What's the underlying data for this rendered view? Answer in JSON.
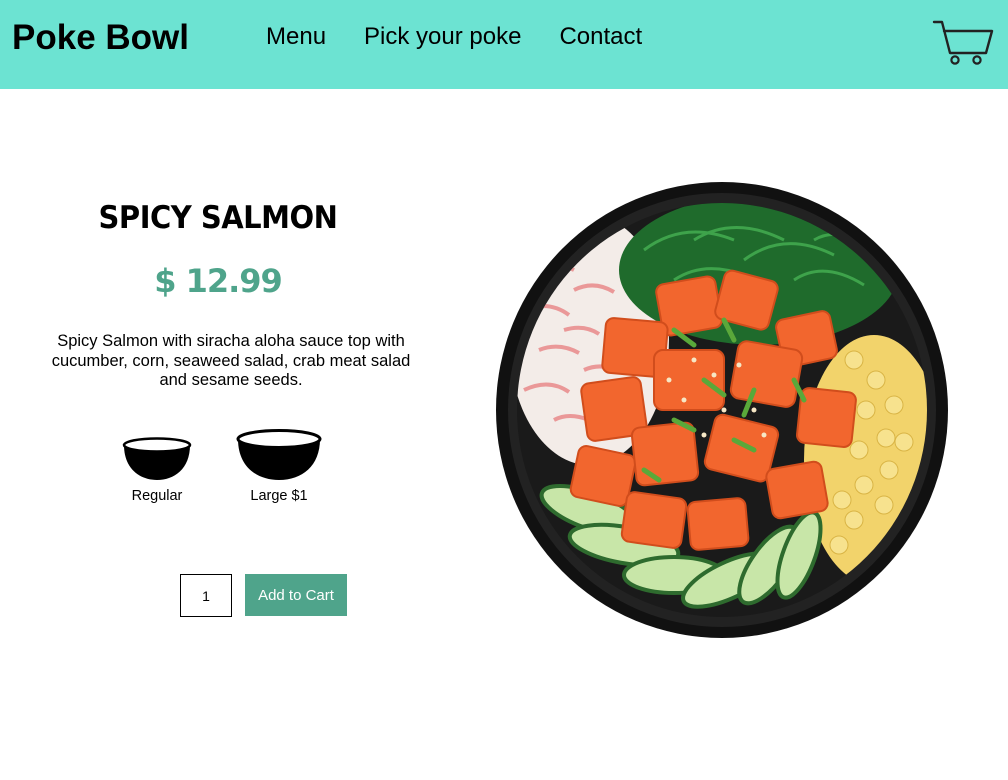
{
  "header": {
    "logo": "Poke Bowl",
    "nav": [
      "Menu",
      "Pick your poke",
      "Contact"
    ],
    "cart_icon": "shopping-cart-icon"
  },
  "product": {
    "title": "SPICY SALMON",
    "price": "$ 12.99",
    "description": "Spicy Salmon with siracha aloha sauce top with cucumber, corn, seaweed salad, crab meat salad and sesame seeds.",
    "sizes": [
      {
        "label": "Regular",
        "icon": "small-bowl-icon"
      },
      {
        "label": "Large $1",
        "icon": "large-bowl-icon"
      }
    ],
    "quantity": "1",
    "add_to_cart": "Add to Cart",
    "image": "poke-bowl-image"
  },
  "colors": {
    "header_bg": "#6ce3d2",
    "accent": "#4fa48b"
  }
}
